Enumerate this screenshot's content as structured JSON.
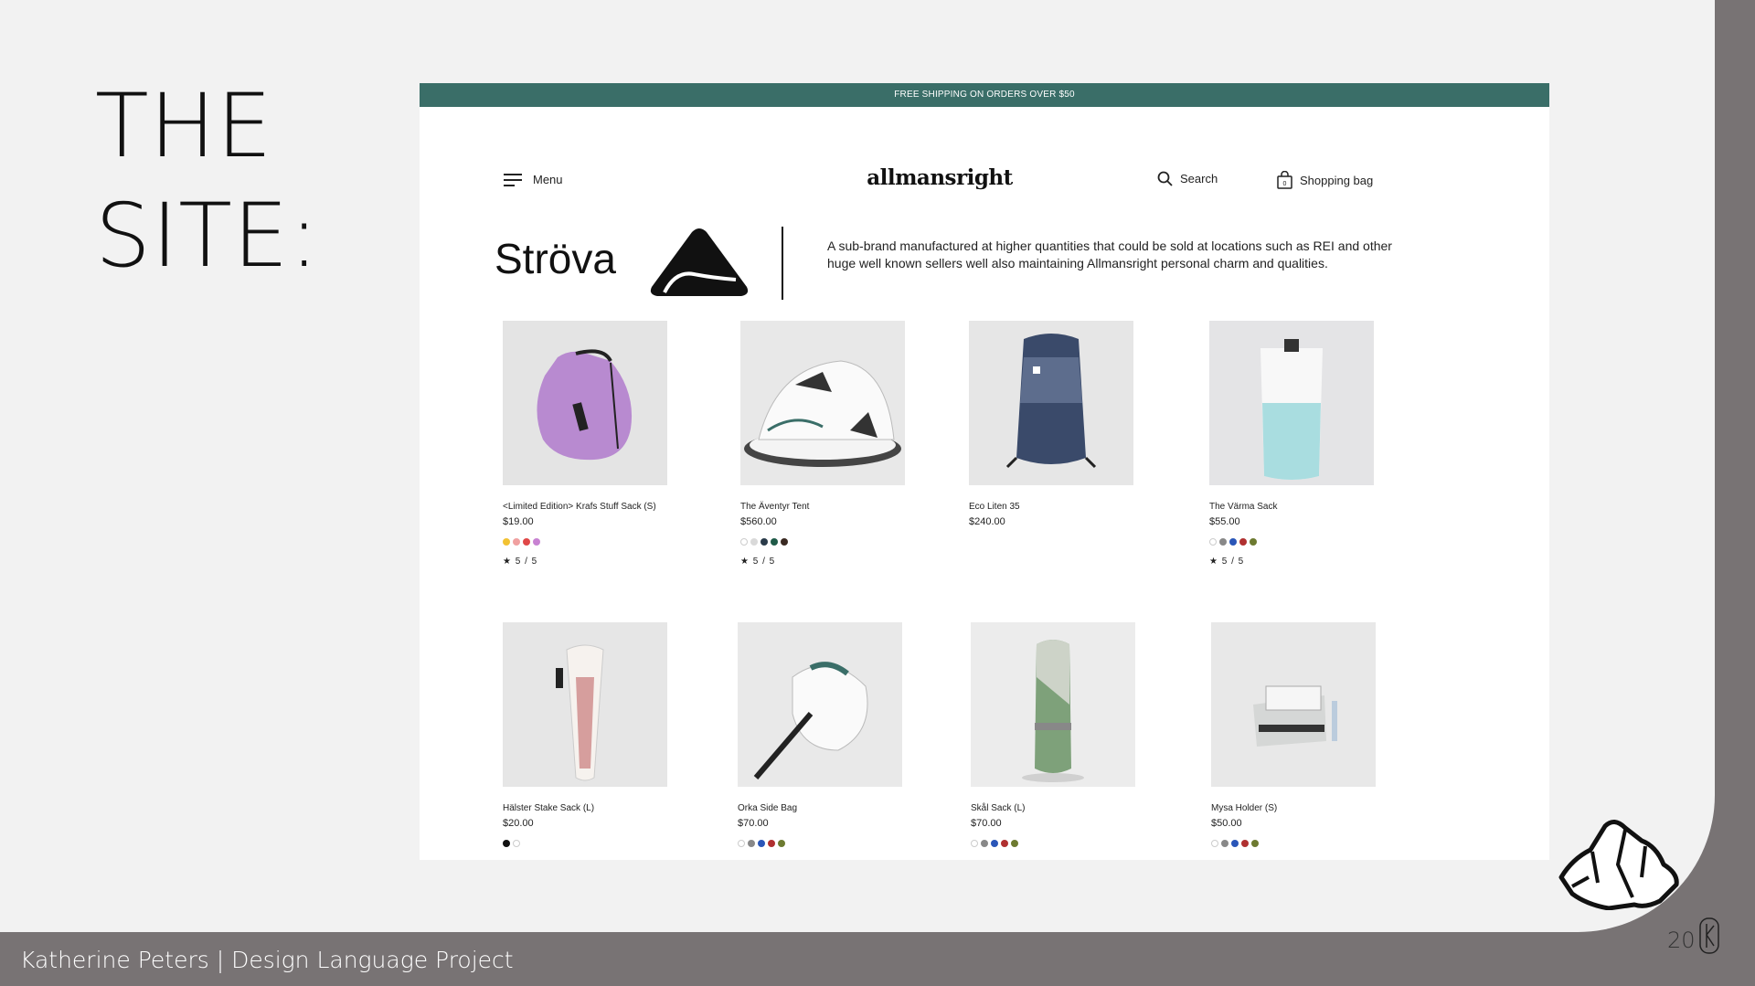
{
  "slide": {
    "title_line1": "THE",
    "title_line2": "SITE:",
    "footer": "Katherine Peters | Design Language Project",
    "page_number": "20"
  },
  "site": {
    "banner": "FREE SHIPPING ON ORDERS OVER $50",
    "menu_label": "Menu",
    "wordmark": "allmansright",
    "search_label": "Search",
    "bag_label": "Shopping bag",
    "bag_count": "0",
    "brand_name": "Ströva",
    "brand_description": "A sub-brand manufactured at higher quantities that could be sold at locations such as REI and other huge well known sellers well also maintaining Allmansright personal charm and qualities.",
    "products": [
      {
        "name": "<Limited Edition> Krafs Stuff Sack (S)",
        "price": "$19.00",
        "swatches": [
          "#f2c233",
          "#f0a0a0",
          "#e04848",
          "#c882d2"
        ],
        "rating": "★ 5 / 5"
      },
      {
        "name": "The Äventyr Tent",
        "price": "$560.00",
        "swatches": [
          "#ffffff",
          "#d9d9d9",
          "#2a3b4a",
          "#1f5a48",
          "#3a2a22"
        ],
        "rating": "★ 5 / 5"
      },
      {
        "name": "Eco Liten 35",
        "price": "$240.00",
        "swatches": [],
        "rating": ""
      },
      {
        "name": "The Värma Sack",
        "price": "$55.00",
        "swatches": [
          "#ffffff",
          "#888888",
          "#2a56b8",
          "#b03030",
          "#6d7a30"
        ],
        "rating": "★ 5 / 5"
      },
      {
        "name": "Hälster Stake Sack (L)",
        "price": "$20.00",
        "swatches": [
          "#111111",
          "#ffffff"
        ],
        "rating": ""
      },
      {
        "name": "Orka Side Bag",
        "price": "$70.00",
        "swatches": [
          "#ffffff",
          "#888888",
          "#2a56b8",
          "#b03030",
          "#6d7a30"
        ],
        "rating": ""
      },
      {
        "name": "Skål Sack (L)",
        "price": "$70.00",
        "swatches": [
          "#ffffff",
          "#888888",
          "#2a56b8",
          "#b03030",
          "#6d7a30"
        ],
        "rating": ""
      },
      {
        "name": "Mysa Holder (S)",
        "price": "$50.00",
        "swatches": [
          "#ffffff",
          "#888888",
          "#2a56b8",
          "#b03030",
          "#6d7a30"
        ],
        "rating": ""
      }
    ]
  }
}
